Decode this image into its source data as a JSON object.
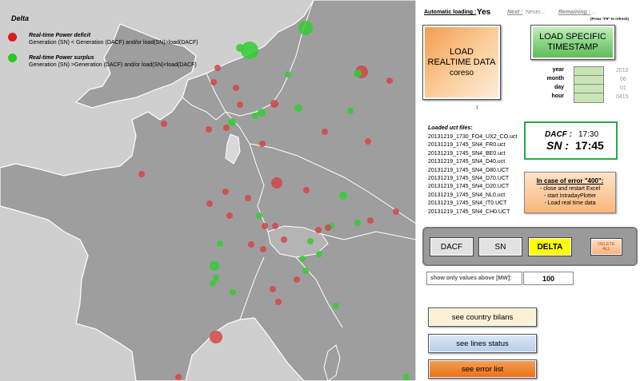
{
  "legend": {
    "title": "Delta",
    "deficit_heading": "Real-time Power deficit",
    "deficit_desc": "Generation (SN) < Generation (DACF) and/or load(SN)>load(DACF)",
    "surplus_heading": "Real-time Power surplus",
    "surplus_desc": "Generation (SN) >Generation (DACF) and/or load(SN)<load(DACF)",
    "deficit_color": "#d64040",
    "surplus_color": "#33cc33"
  },
  "status": {
    "auto_label": "Automatic loading :",
    "auto_value": "Yes",
    "next_label": "Next :",
    "next_value": "Never...",
    "remaining_label": "Remaining :",
    "remaining_value": "...",
    "refresh_hint": "(Press \"F9\" to refresh)"
  },
  "load_button": {
    "line1": "LOAD",
    "line2": "REALTIME DATA",
    "line3": "coreso"
  },
  "load_specific_button": {
    "line1": "LOAD SPECIFIC",
    "line2": "TIMESTAMP"
  },
  "timestamp": {
    "year_label": "year",
    "year_value": "2010",
    "month_label": "month",
    "month_value": "06",
    "day_label": "day",
    "day_value": "01",
    "hour_label": "hour",
    "hour_value": "0415"
  },
  "dot_mark": "1",
  "files": {
    "title": "Loaded uct files:",
    "list": [
      "20131219_1730_FO4_UX2_CO.uct",
      "20131219_1745_SN4_FR0.uct",
      "20131219_1745_SN4_BE0.uct",
      "20131219_1745_SN4_D40.uct",
      "20131219_1745_SN4_D80.UCT",
      "20131219_1745_SN4_D70.UCT",
      "20131219_1745_SN4_D20.UCT",
      "20131219_1745_SN4_NL0.uct",
      "20131219_1745_SN4_IT0.UCT",
      "20131219_1745_SN4_CH0.UCT"
    ]
  },
  "clock": {
    "dacf_label": "DACF :",
    "dacf_value": "17:30",
    "sn_label": "SN :",
    "sn_value": "17:45"
  },
  "error_box": {
    "title": "In case of error \"400\":",
    "line1": "- close and restart Excel",
    "line2": "- start IntradayPlotter",
    "line3": "- Load real time data"
  },
  "toolbar": {
    "dacf": "DACF",
    "sn": "SN",
    "delta": "DELTA",
    "delete_line1": "DELETE",
    "delete_line2": "ALL"
  },
  "filter": {
    "label": "show only values above [MW]:",
    "value": "100"
  },
  "buttons": {
    "country_bilans": "see country bilans",
    "lines_status": "see lines status",
    "error_list": "see error list"
  },
  "colors": {
    "land": "#9e9e9e",
    "sea": "#cfcfcf",
    "border": "#ffffff",
    "clock_border": "#2aa84a",
    "delta_button": "#ffff00",
    "country_bilans_bg": "#fbf1d4",
    "lines_status_bg": "#c6daf2",
    "error_list_bg": "#f07b23"
  }
}
